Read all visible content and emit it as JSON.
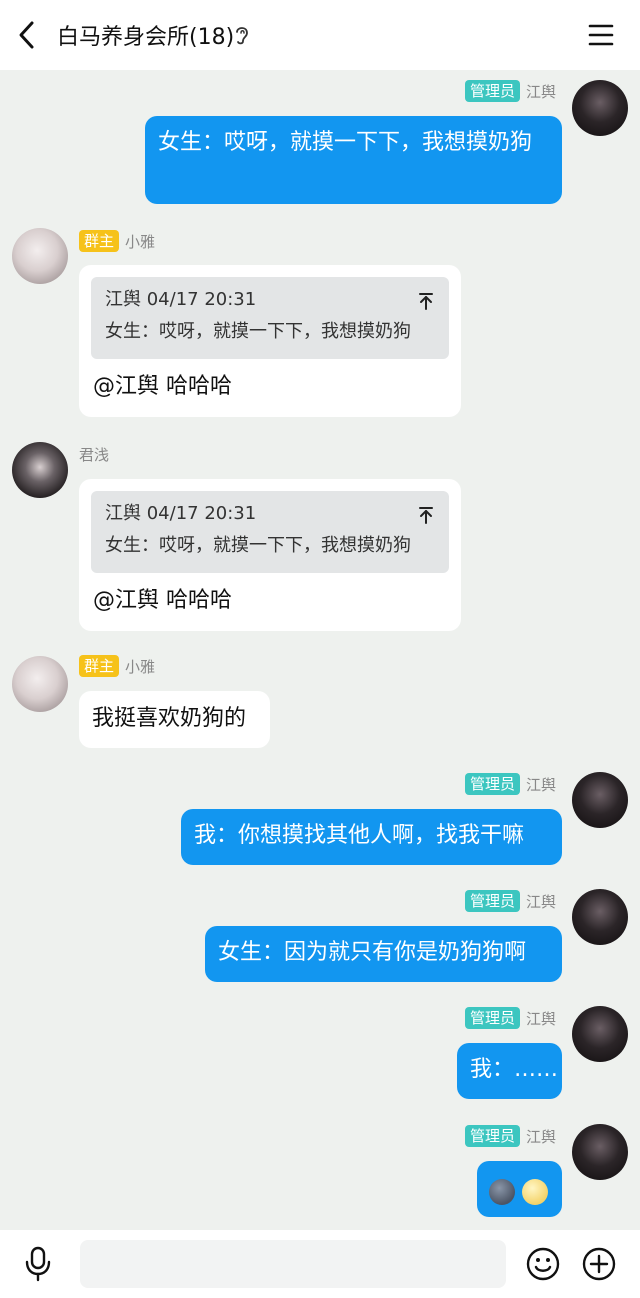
{
  "header": {
    "title": "白马养身会所(18)"
  },
  "messages": [
    {
      "role": "管理员",
      "name": "江舆",
      "text": "女生：哎呀，就摸一下下，我想摸奶狗"
    },
    {
      "role": "群主",
      "name": "小雅",
      "quote_head": "江舆 04/17 20:31",
      "quote_text": "女生：哎呀，就摸一下下，我想摸奶狗",
      "text": "@江舆 哈哈哈"
    },
    {
      "name": "君浅",
      "quote_head": "江舆 04/17 20:31",
      "quote_text": "女生：哎呀，就摸一下下，我想摸奶狗",
      "text": "@江舆 哈哈哈"
    },
    {
      "role": "群主",
      "name": "小雅",
      "text": "我挺喜欢奶狗的"
    },
    {
      "role": "管理员",
      "name": "江舆",
      "text": "我：你想摸找其他人啊，找我干嘛"
    },
    {
      "role": "管理员",
      "name": "江舆",
      "text": "女生：因为就只有你是奶狗狗啊"
    },
    {
      "role": "管理员",
      "name": "江舆",
      "text": "我：……"
    },
    {
      "role": "管理员",
      "name": "江舆",
      "emojis": [
        "new-moon-face",
        "full-moon-face"
      ]
    }
  ],
  "colors": {
    "outgoing_bubble": "#1296f0",
    "admin_badge": "#3cc6c0",
    "owner_badge": "#f6c21a"
  }
}
